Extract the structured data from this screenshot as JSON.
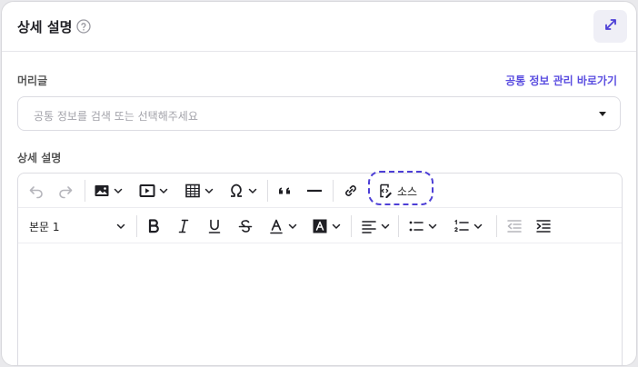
{
  "header": {
    "title": "상세 설명"
  },
  "header_section": {
    "label": "머리글",
    "link_label": "공통 정보 관리 바로가기",
    "select_placeholder": "공통 정보를 검색 또는 선택해주세요"
  },
  "description": {
    "label": "상세 설명"
  },
  "toolbar": {
    "source_label": "소스",
    "paragraph_style": "본문 1"
  },
  "icons": {
    "help": "help-circle-icon",
    "expand": "expand-arrows-icon",
    "undo": "undo-icon",
    "redo": "redo-icon",
    "image": "image-icon",
    "media": "media-icon",
    "table": "table-icon",
    "special_char": "omega-icon",
    "blockquote": "quote-icon",
    "horizontal_line": "horizontal-line-icon",
    "link": "link-icon",
    "source": "source-code-icon"
  },
  "colors": {
    "accent": "#5a4de0",
    "dashed_highlight": "#4d3fd6"
  }
}
